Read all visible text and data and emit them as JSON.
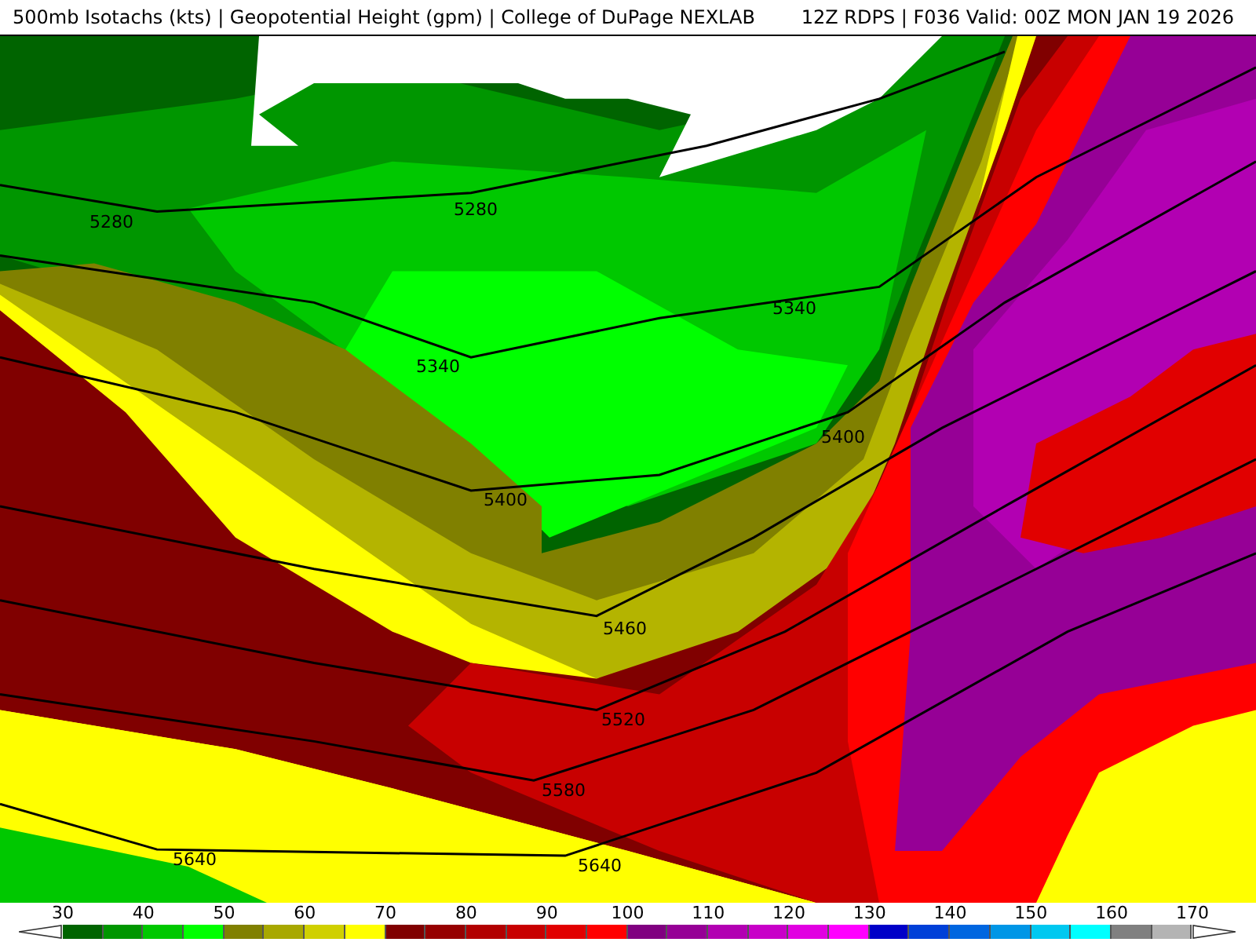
{
  "header": {
    "title": "500mb Isotachs (kts) | Geopotential Height (gpm) | College of DuPage NEXLAB",
    "run_info": "12Z RDPS | F036 Valid: 00Z MON JAN 19 2026"
  },
  "map": {
    "contour_labels": [
      "5280",
      "5280",
      "5340",
      "5340",
      "5400",
      "5400",
      "5460",
      "5520",
      "5580",
      "5640",
      "5640"
    ]
  },
  "colorbar": {
    "ticks": [
      "30",
      "40",
      "50",
      "60",
      "70",
      "80",
      "90",
      "100",
      "110",
      "120",
      "130",
      "140",
      "150",
      "160",
      "170"
    ],
    "swatches": [
      {
        "color": "#006400"
      },
      {
        "color": "#009600"
      },
      {
        "color": "#00c800"
      },
      {
        "color": "#00ff00"
      },
      {
        "color": "#808000"
      },
      {
        "color": "#a8a800"
      },
      {
        "color": "#d0d000"
      },
      {
        "color": "#ffff00"
      },
      {
        "color": "#800000"
      },
      {
        "color": "#960000"
      },
      {
        "color": "#b20000"
      },
      {
        "color": "#c80000"
      },
      {
        "color": "#e10000"
      },
      {
        "color": "#ff0000"
      },
      {
        "color": "#800080"
      },
      {
        "color": "#960096"
      },
      {
        "color": "#b200b2"
      },
      {
        "color": "#c800c8"
      },
      {
        "color": "#e100e1"
      },
      {
        "color": "#ff00ff"
      },
      {
        "color": "#0000c8"
      },
      {
        "color": "#0040d8"
      },
      {
        "color": "#0066e0"
      },
      {
        "color": "#0096e6"
      },
      {
        "color": "#00c8f0"
      },
      {
        "color": "#00ffff"
      },
      {
        "color": "#808080"
      },
      {
        "color": "#b4b4b4"
      }
    ]
  }
}
